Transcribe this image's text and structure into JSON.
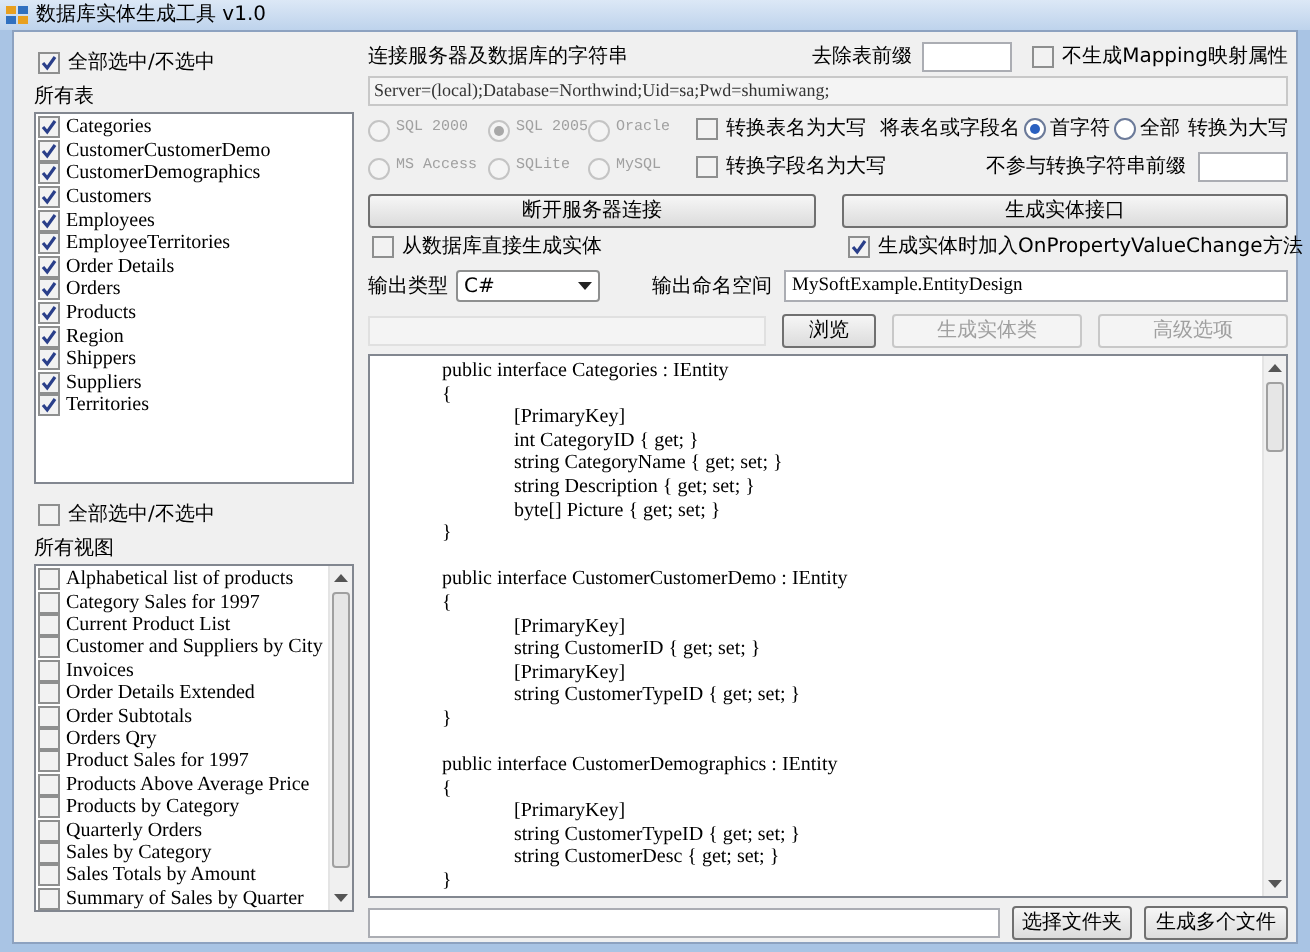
{
  "window": {
    "title": "数据库实体生成工具 v1.0"
  },
  "tables_panel": {
    "select_all": {
      "label": "全部选中/不选中",
      "checked": true
    },
    "heading": "所有表",
    "items": [
      {
        "name": "Categories",
        "checked": true
      },
      {
        "name": "CustomerCustomerDemo",
        "checked": true
      },
      {
        "name": "CustomerDemographics",
        "checked": true
      },
      {
        "name": "Customers",
        "checked": true
      },
      {
        "name": "Employees",
        "checked": true
      },
      {
        "name": "EmployeeTerritories",
        "checked": true
      },
      {
        "name": "Order Details",
        "checked": true
      },
      {
        "name": "Orders",
        "checked": true
      },
      {
        "name": "Products",
        "checked": true
      },
      {
        "name": "Region",
        "checked": true
      },
      {
        "name": "Shippers",
        "checked": true
      },
      {
        "name": "Suppliers",
        "checked": true
      },
      {
        "name": "Territories",
        "checked": true
      }
    ]
  },
  "views_panel": {
    "select_all": {
      "label": "全部选中/不选中",
      "checked": false
    },
    "heading": "所有视图",
    "items": [
      {
        "name": "Alphabetical list of products",
        "checked": false
      },
      {
        "name": "Category Sales for 1997",
        "checked": false
      },
      {
        "name": "Current Product List",
        "checked": false
      },
      {
        "name": "Customer and Suppliers by City",
        "checked": false
      },
      {
        "name": "Invoices",
        "checked": false
      },
      {
        "name": "Order Details Extended",
        "checked": false
      },
      {
        "name": "Order Subtotals",
        "checked": false
      },
      {
        "name": "Orders Qry",
        "checked": false
      },
      {
        "name": "Product Sales for 1997",
        "checked": false
      },
      {
        "name": "Products Above Average Price",
        "checked": false
      },
      {
        "name": "Products by Category",
        "checked": false
      },
      {
        "name": "Quarterly Orders",
        "checked": false
      },
      {
        "name": "Sales by Category",
        "checked": false
      },
      {
        "name": "Sales Totals by Amount",
        "checked": false
      },
      {
        "name": "Summary of Sales by Quarter",
        "checked": false
      }
    ]
  },
  "connection": {
    "label": "连接服务器及数据库的字符串",
    "value": "Server=(local);Database=Northwind;Uid=sa;Pwd=shumiwang;"
  },
  "strip_prefix": {
    "label": "去除表前缀"
  },
  "no_mapping": {
    "label": "不生成Mapping映射属性",
    "checked": false
  },
  "db_types": [
    {
      "label": "SQL 2000",
      "selected": false,
      "disabled": true
    },
    {
      "label": "SQL 2005",
      "selected": true,
      "disabled": true
    },
    {
      "label": "Oracle",
      "selected": false,
      "disabled": true
    },
    {
      "label": "MS Access",
      "selected": false,
      "disabled": true
    },
    {
      "label": "SQLite",
      "selected": false,
      "disabled": true
    },
    {
      "label": "MySQL",
      "selected": false,
      "disabled": true
    }
  ],
  "upper_table": {
    "label": "转换表名为大写",
    "checked": false
  },
  "upper_field": {
    "label": "转换字段名为大写",
    "checked": false
  },
  "case_mode": {
    "label": "将表名或字段名",
    "options": [
      {
        "label": "首字符",
        "selected": true
      },
      {
        "label": "全部",
        "selected": false
      }
    ],
    "suffix": "转换为大写"
  },
  "exclude_prefix": {
    "label": "不参与转换字符串前缀"
  },
  "disconnect_button": "断开服务器连接",
  "interface_button": "生成实体接口",
  "direct": {
    "label": "从数据库直接生成实体",
    "checked": false
  },
  "onchange": {
    "label": "生成实体时加入OnPropertyValueChange方法",
    "checked": true
  },
  "output_type": {
    "label": "输出类型",
    "value": "C#"
  },
  "namespace": {
    "label": "输出命名空间",
    "value": "MySoftExample.EntityDesign"
  },
  "action_buttons": [
    {
      "label": "浏览",
      "disabled": false
    },
    {
      "label": "生成实体类",
      "disabled": true
    },
    {
      "label": "高级选项",
      "disabled": true
    }
  ],
  "code": {
    "blocks": [
      [
        "\tpublic interface Categories : IEntity",
        "\t{",
        "\t\t[PrimaryKey]",
        "\t\tint CategoryID { get; }",
        "\t\tstring CategoryName { get; set; }",
        "\t\tstring Description { get; set; }",
        "\t\tbyte[] Picture { get; set; }",
        "\t}"
      ],
      [
        "\tpublic interface CustomerCustomerDemo : IEntity",
        "\t{",
        "\t\t[PrimaryKey]",
        "\t\tstring CustomerID { get; set; }",
        "\t\t[PrimaryKey]",
        "\t\tstring CustomerTypeID { get; set; }",
        "\t}"
      ],
      [
        "\tpublic interface CustomerDemographics : IEntity",
        "\t{",
        "\t\t[PrimaryKey]",
        "\t\tstring CustomerTypeID { get; set; }",
        "\t\tstring CustomerDesc { get; set; }",
        "\t}"
      ]
    ]
  },
  "bottom_buttons": [
    "选择文件夹",
    "生成多个文件"
  ]
}
